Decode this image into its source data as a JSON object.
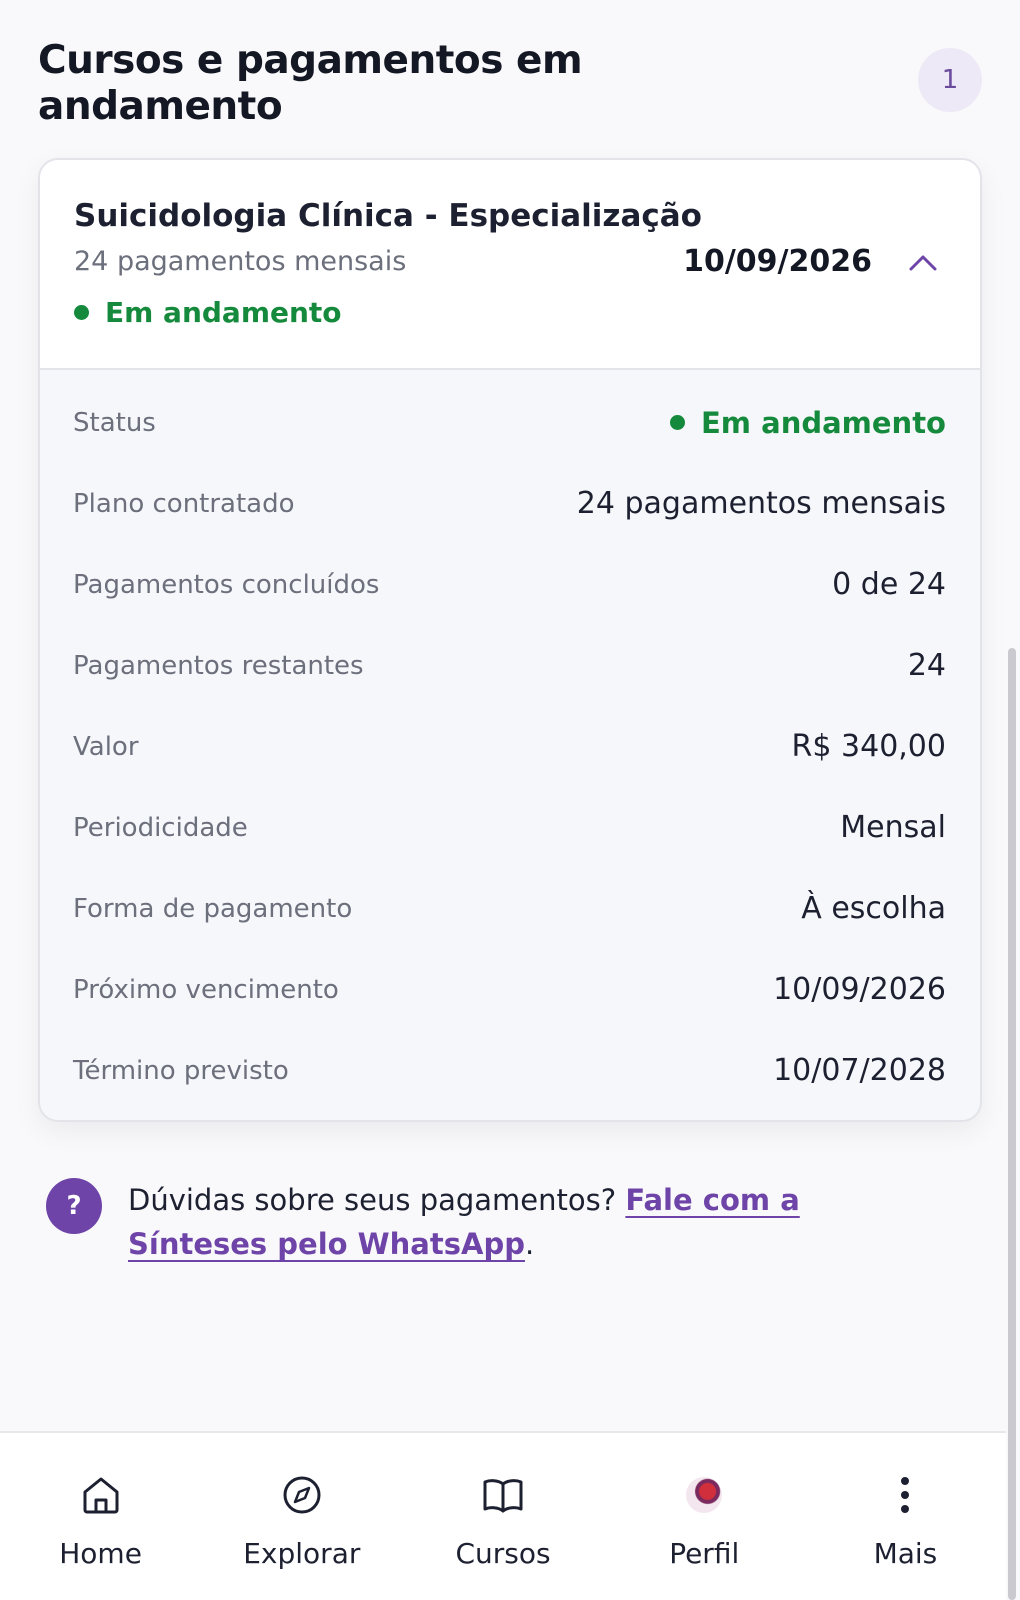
{
  "header": {
    "title": "Cursos e pagamentos em andamento",
    "count": "1"
  },
  "course": {
    "title": "Suicidologia Clínica - Especialização",
    "plan_summary": "24 pagamentos mensais",
    "status": "Em andamento",
    "next_date": "10/09/2026",
    "details": [
      {
        "label": "Status",
        "value": "Em andamento"
      },
      {
        "label": "Plano contratado",
        "value": "24 pagamentos mensais"
      },
      {
        "label": "Pagamentos concluídos",
        "value": "0 de 24"
      },
      {
        "label": "Pagamentos restantes",
        "value": "24"
      },
      {
        "label": "Valor",
        "value": "R$ 340,00"
      },
      {
        "label": "Periodicidade",
        "value": "Mensal"
      },
      {
        "label": "Forma de pagamento",
        "value": "À escolha"
      },
      {
        "label": "Próximo vencimento",
        "value": "10/09/2026"
      },
      {
        "label": "Término previsto",
        "value": "10/07/2028"
      }
    ]
  },
  "help": {
    "icon_text": "?",
    "text": "Dúvidas sobre seus pagamentos? ",
    "link": "Fale com a Sínteses pelo WhatsApp",
    "suffix": "."
  },
  "nav": {
    "items": [
      {
        "label": "Home",
        "icon": "home-icon"
      },
      {
        "label": "Explorar",
        "icon": "compass-icon"
      },
      {
        "label": "Cursos",
        "icon": "book-icon"
      },
      {
        "label": "Perfil",
        "icon": "avatar"
      },
      {
        "label": "Mais",
        "icon": "more-vertical-icon"
      }
    ]
  },
  "colors": {
    "accent": "#6e44a8",
    "status_green": "#158a3c",
    "badge_bg": "#ede9f6"
  }
}
